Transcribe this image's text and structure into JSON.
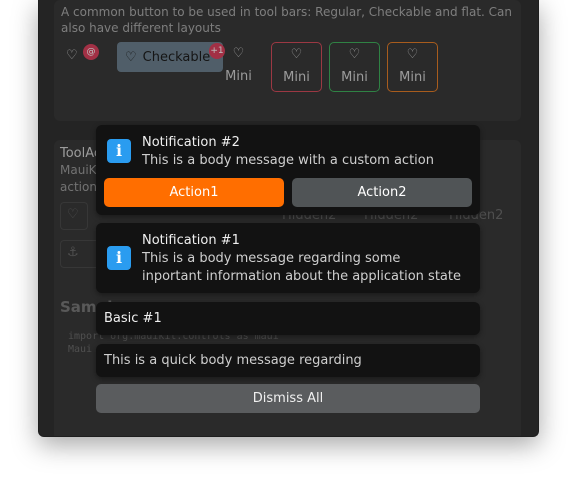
{
  "section1": {
    "description": "A common button to be used in tool bars: Regular, Checkable and flat. Can also have different layouts",
    "checkable_label": "Checkable",
    "badge_at": "@",
    "badge_plus": "+1",
    "mini_label": "Mini",
    "mini_colors": [
      "#d04b5a",
      "#3fae5b",
      "#e07b27"
    ]
  },
  "section2": {
    "title": "ToolAc",
    "line1": "MauiK",
    "line2": "actions",
    "hidden_label": "Hidden2",
    "sample_title": "Sample",
    "code_line1": "import org.mauikit.controls as maui",
    "code_line2": "Maui"
  },
  "notifications": {
    "n2": {
      "title": "Notification #2",
      "body": "This is a body message with a custom action",
      "action1": "Action1",
      "action2": "Action2"
    },
    "n1": {
      "title": "Notification #1",
      "body": "This is a body message regarding some inportant information about the application state"
    },
    "basic": {
      "title": "Basic #1"
    },
    "quick": {
      "body": "This is a quick body message regarding"
    },
    "dismiss_all": "Dismiss All"
  },
  "colors": {
    "accent": "#ff6e00",
    "info": "#2a9cf0",
    "secondary_btn": "#505456"
  }
}
